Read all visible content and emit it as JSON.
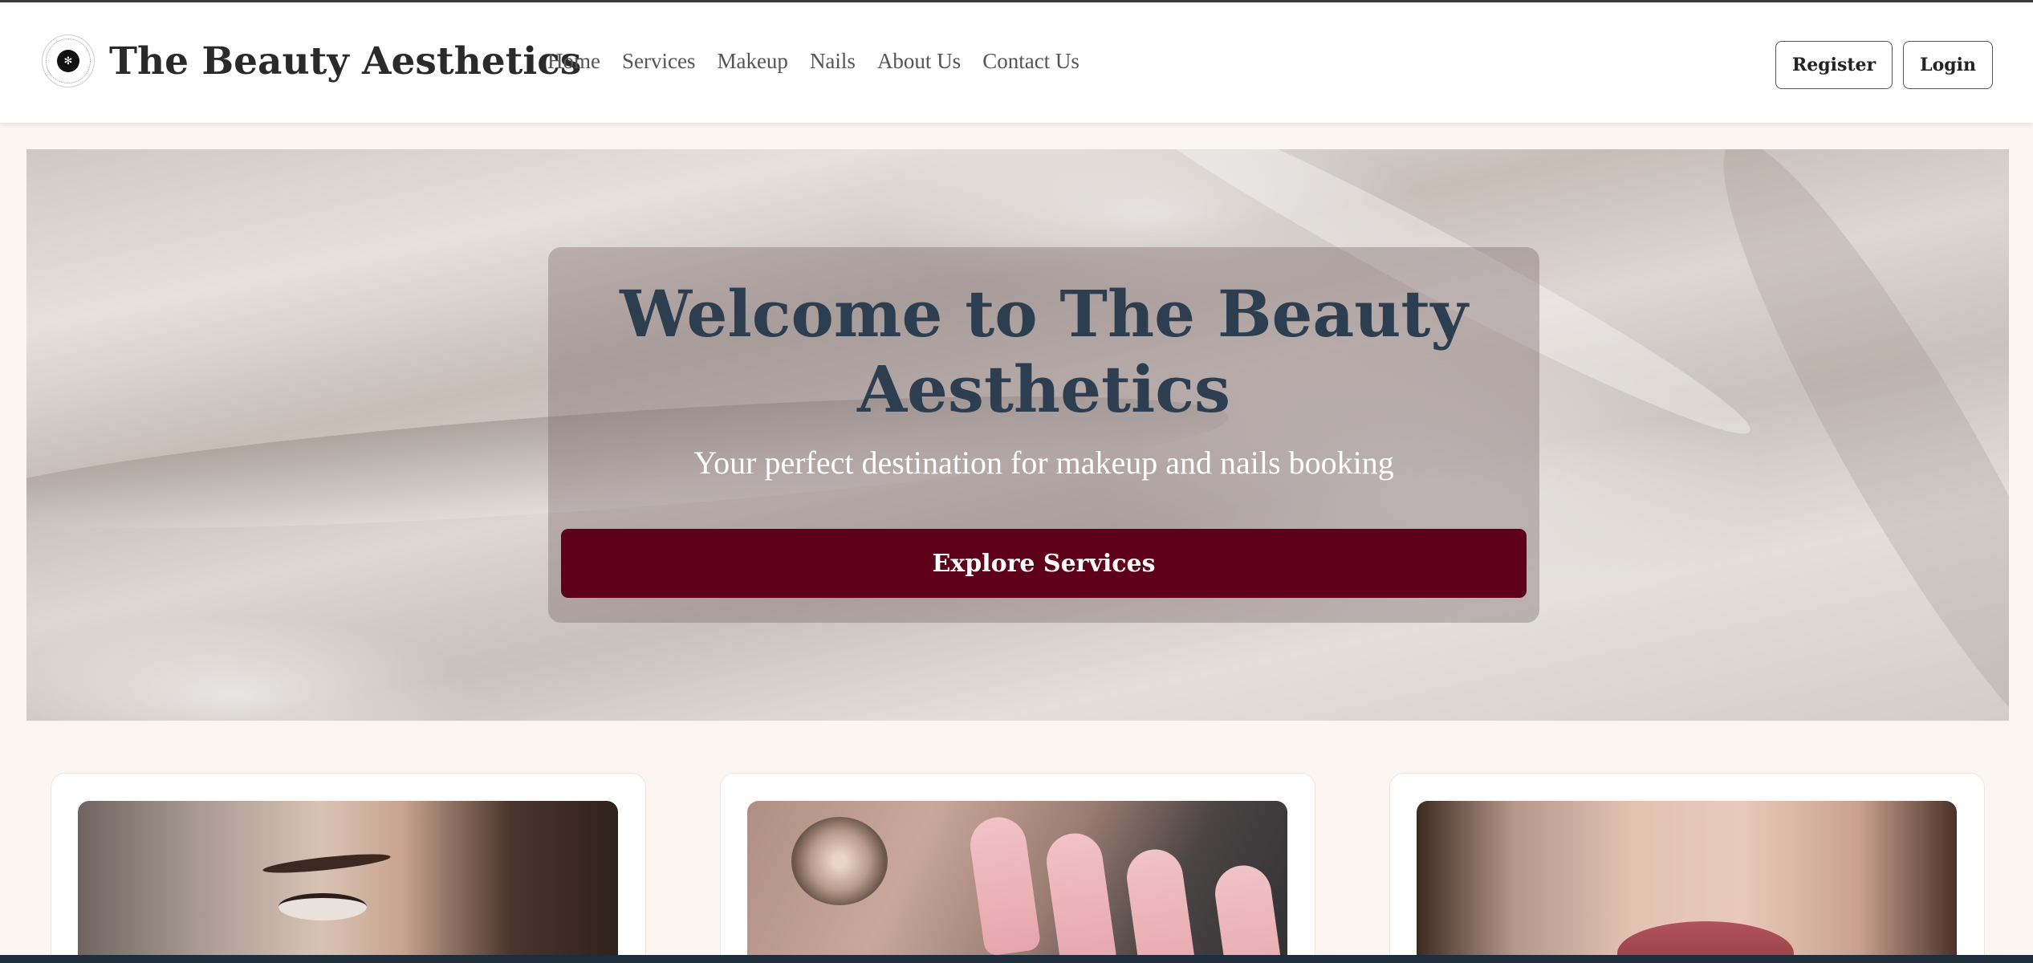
{
  "header": {
    "brand_name": "The Beauty Aesthetics",
    "logo_icon": "brand-logo-icon",
    "nav": [
      "Home",
      "Services",
      "Makeup",
      "Nails",
      "About Us",
      "Contact Us"
    ],
    "register_label": "Register",
    "login_label": "Login"
  },
  "hero": {
    "title": "Welcome to The Beauty Aesthetics",
    "subtitle": "Your perfect destination for makeup and nails booking",
    "cta_label": "Explore Services",
    "cta_color": "#5e0019",
    "title_color": "#2c3e50"
  },
  "cards": [
    {
      "image": "eye-makeup-photo"
    },
    {
      "image": "nail-art-photo"
    },
    {
      "image": "lips-makeup-photo"
    }
  ],
  "colors": {
    "page_background": "#fdf5f1",
    "accent": "#5e0019"
  }
}
